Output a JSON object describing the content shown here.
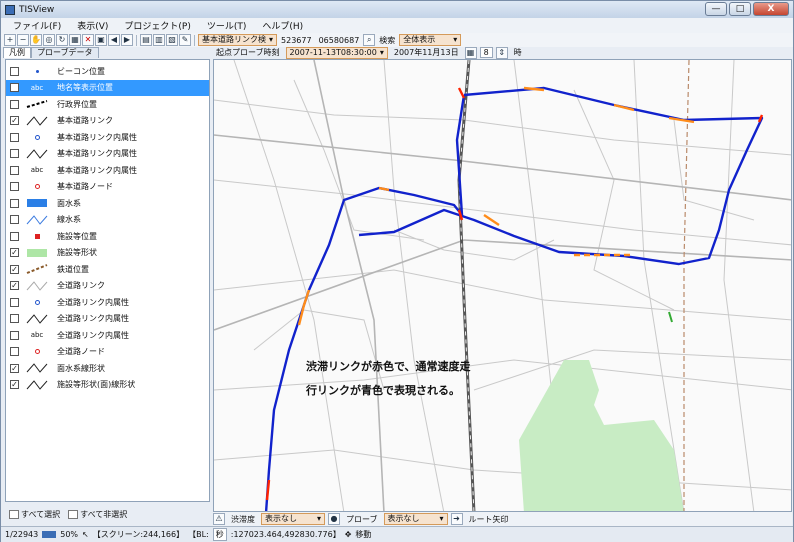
{
  "window": {
    "title": "TISView",
    "min": "—",
    "max": "□",
    "close": "X"
  },
  "menu": [
    "ファイル(F)",
    "表示(V)",
    "プロジェクト(P)",
    "ツール(T)",
    "ヘルプ(H)"
  ],
  "toolbar": {
    "search_type": "基本道路リンク検",
    "coord1": "523677",
    "coord2": "06580687",
    "search_label": "検索",
    "display_mode": "全体表示"
  },
  "tabs": [
    "凡例",
    "プローブデータ"
  ],
  "probe": {
    "start_label": "起点プローブ時刻",
    "start_time": "2007-11-13T08:30:00",
    "date": "2007年11月13日",
    "hour": "8",
    "hour_unit": "時"
  },
  "legend": [
    {
      "label": "ビーコン位置",
      "checked": false,
      "symbol": "dot-blue"
    },
    {
      "label": "地名等表示位置",
      "checked": false,
      "symbol": "abc",
      "selected": true
    },
    {
      "label": "行政界位置",
      "checked": false,
      "symbol": "dashline"
    },
    {
      "label": "基本道路リンク",
      "checked": true,
      "symbol": "line"
    },
    {
      "label": "基本道路リンク内属性",
      "checked": false,
      "symbol": "circle-blue"
    },
    {
      "label": "基本道路リンク内属性",
      "checked": false,
      "symbol": "line"
    },
    {
      "label": "基本道路リンク内属性",
      "checked": false,
      "symbol": "abc"
    },
    {
      "label": "基本道路ノード",
      "checked": false,
      "symbol": "circle-red"
    },
    {
      "label": "面水系",
      "checked": false,
      "symbol": "rect-blue"
    },
    {
      "label": "線水系",
      "checked": false,
      "symbol": "line-blue"
    },
    {
      "label": "施設等位置",
      "checked": false,
      "symbol": "square-red"
    },
    {
      "label": "施設等形状",
      "checked": true,
      "symbol": "rect-green"
    },
    {
      "label": "鉄道位置",
      "checked": true,
      "symbol": "rail"
    },
    {
      "label": "全道路リンク",
      "checked": true,
      "symbol": "line-light"
    },
    {
      "label": "全道路リンク内属性",
      "checked": false,
      "symbol": "circle-blue"
    },
    {
      "label": "全道路リンク内属性",
      "checked": false,
      "symbol": "line"
    },
    {
      "label": "全道路リンク内属性",
      "checked": false,
      "symbol": "abc"
    },
    {
      "label": "全道路ノード",
      "checked": false,
      "symbol": "circle-red"
    },
    {
      "label": "面水系線形状",
      "checked": true,
      "symbol": "line"
    },
    {
      "label": "施設等形状(面)線形状",
      "checked": true,
      "symbol": "line"
    }
  ],
  "panel_footer": {
    "select_all": "すべて選択",
    "deselect_all": "すべて非選択"
  },
  "map": {
    "annotation": "渋滞リンクが赤色で、通常速度走行リンクが青色で表現される。",
    "colors": {
      "congested": "#ff2200",
      "normal": "#1122cc",
      "mid": "#ff8c1a",
      "park": "#c8ecc4",
      "rail": "#b98a6a"
    }
  },
  "layerbar": {
    "congestion_label": "渋滞度",
    "congestion_value": "表示なし",
    "probe_label": "プローブ",
    "probe_value": "表示なし",
    "route_label": "ルート矢印"
  },
  "status": {
    "scale": "1/22943",
    "zoom": "50%",
    "screen": "【スクリーン:244,166】",
    "bl_label": "【BL:",
    "bl_value": "秒",
    "bl_coords": ":127023.464,492830.776】",
    "mode": "移動"
  }
}
